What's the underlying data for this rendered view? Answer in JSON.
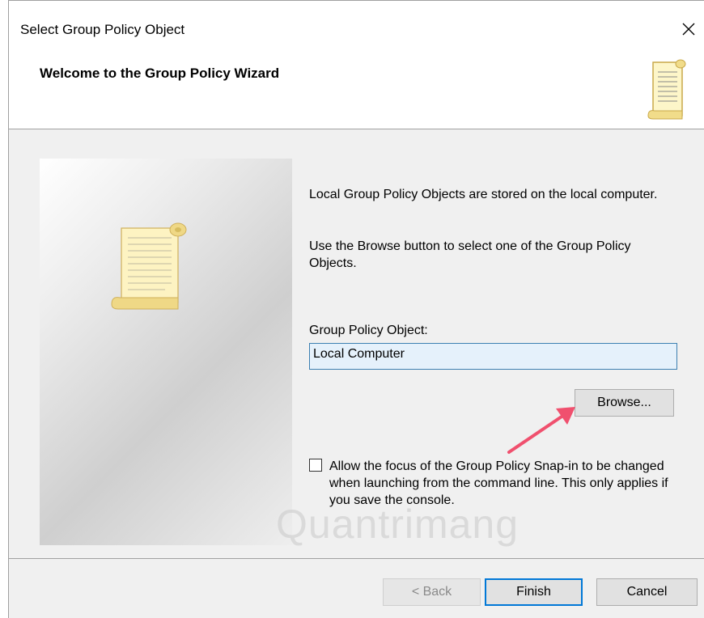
{
  "window": {
    "title": "Select Group Policy Object",
    "close_glyph": "✕"
  },
  "header": {
    "title": "Welcome to the Group Policy Wizard",
    "icon": "scroll-icon"
  },
  "content": {
    "para1": "Local Group Policy Objects are stored on the local computer.",
    "para2": "Use the Browse button to select one of the Group Policy Objects.",
    "gpo_label": "Group Policy Object:",
    "gpo_value": "Local Computer",
    "browse_label": "Browse...",
    "checkbox_label": "Allow the focus of the Group Policy Snap-in to be changed when launching from the command line. This only applies if you save the console.",
    "checkbox_checked": false
  },
  "footer": {
    "back_label": "< Back",
    "finish_label": "Finish",
    "cancel_label": "Cancel"
  },
  "watermark": "Quantrimang",
  "colors": {
    "accent": "#0078d7",
    "arrow": "#f0506e"
  }
}
